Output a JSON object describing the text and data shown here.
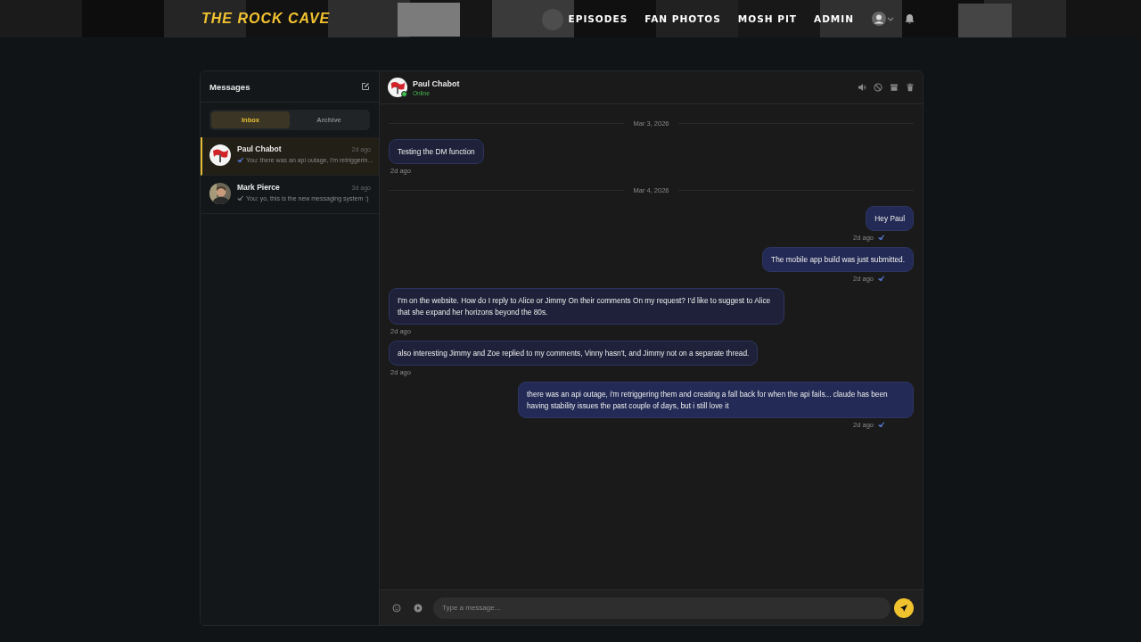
{
  "nav": {
    "logo": "THE ROCK CAVE",
    "links": [
      "EPISODES",
      "FAN PHOTOS",
      "MOSH PIT",
      "ADMIN"
    ]
  },
  "sidebar": {
    "title": "Messages",
    "tabs": [
      {
        "label": "Inbox",
        "selected": true
      },
      {
        "label": "Archive",
        "selected": false
      }
    ],
    "conversations": [
      {
        "name": "Paul Chabot",
        "time": "2d ago",
        "preview": "You: there was an api outage, i'm retriggerin...",
        "read": true,
        "selected": true,
        "kind": "flag"
      },
      {
        "name": "Mark Pierce",
        "time": "3d ago",
        "preview": "You: yo, this is the new messaging system :)",
        "read": false,
        "selected": false,
        "kind": "picture"
      }
    ]
  },
  "chat": {
    "name": "Paul Chabot",
    "status": "Online",
    "online": true,
    "messages": [
      {
        "kind": "date",
        "text": "Mar 3, 2026"
      },
      {
        "kind": "incoming",
        "text": "Testing the DM function",
        "time": "2d ago"
      },
      {
        "kind": "date",
        "text": "Mar 4, 2026"
      },
      {
        "kind": "outgoing",
        "text": "Hey Paul",
        "time": "2d ago"
      },
      {
        "kind": "outgoing",
        "text": "The mobile app build was just submitted.",
        "time": "2d ago"
      },
      {
        "kind": "incoming",
        "text": "I'm on the website. How do I reply to Alice or Jimmy On their comments On my request? I'd like to suggest to Alice that she expand her horizons beyond the 80s.",
        "time": "2d ago"
      },
      {
        "kind": "incoming",
        "text": "also interesting Jimmy and Zoe replied to my comments, Vinny hasn't, and Jimmy not on a separate thread.",
        "time": "2d ago"
      },
      {
        "kind": "outgoing",
        "text": "there was an api outage, i'm retriggering them and creating a fall back for when the api fails... claude has been having stability issues the past couple of days, but i still love it",
        "time": "2d ago"
      }
    ],
    "input": {
      "placeholder": "Type a message..."
    }
  }
}
